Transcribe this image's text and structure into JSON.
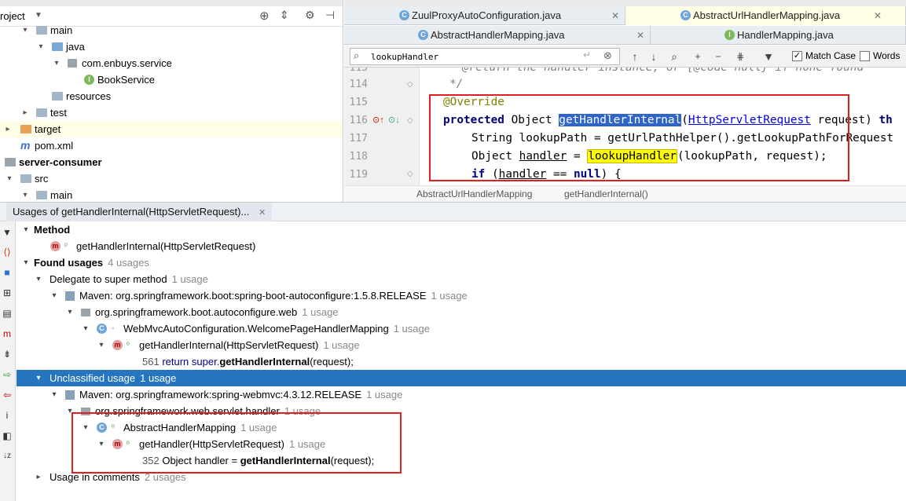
{
  "project": {
    "title": "roject",
    "tree": [
      {
        "label": "main",
        "indent": 1,
        "arrow": "down",
        "icon": "folder"
      },
      {
        "label": "java",
        "indent": 2,
        "arrow": "down",
        "icon": "folder-blue"
      },
      {
        "label": "com.enbuys.service",
        "indent": 3,
        "arrow": "down",
        "icon": "package"
      },
      {
        "label": "BookService",
        "indent": 4,
        "arrow": "",
        "icon": "interface"
      },
      {
        "label": "resources",
        "indent": 2,
        "arrow": "",
        "icon": "folder"
      },
      {
        "label": "test",
        "indent": 1,
        "arrow": "right",
        "icon": "folder"
      },
      {
        "label": "target",
        "indent": 0,
        "arrow": "right",
        "icon": "folder-orange"
      },
      {
        "label": "pom.xml",
        "indent": 0,
        "arrow": "",
        "icon": "maven"
      },
      {
        "label": "server-consumer",
        "indent": -1,
        "arrow": "",
        "icon": "module"
      },
      {
        "label": "src",
        "indent": 0,
        "arrow": "down",
        "icon": "folder"
      },
      {
        "label": "main",
        "indent": 1,
        "arrow": "down",
        "icon": "folder"
      }
    ]
  },
  "editor": {
    "tabs_row1": [
      {
        "label": "ZuulProxyAutoConfiguration.java",
        "active": false
      },
      {
        "label": "AbstractUrlHandlerMapping.java",
        "active": true
      }
    ],
    "tabs_row2": [
      {
        "label": "AbstractHandlerMapping.java",
        "active": false
      },
      {
        "label": "HandlerMapping.java",
        "active": false
      }
    ],
    "search": {
      "value": "lookupHandler",
      "match_case_label": "Match Case",
      "match_case_checked": true,
      "words_label": "Words",
      "words_checked": false
    },
    "lines": [
      {
        "num": "113",
        "text": "@return the handler instance, or {@code null} if none found"
      },
      {
        "num": "114",
        "text": "*/"
      },
      {
        "num": "115",
        "text": "@Override"
      },
      {
        "num": "116",
        "text": "protected Object getHandlerInternal(HttpServletRequest request) th"
      },
      {
        "num": "117",
        "text": "String lookupPath = getUrlPathHelper().getLookupPathForRequest"
      },
      {
        "num": "118",
        "text": "Object handler = lookupHandler(lookupPath, request);"
      },
      {
        "num": "119",
        "text": "if (handler == null) {"
      }
    ],
    "breadcrumb": [
      "AbstractUrlHandlerMapping",
      "getHandlerInternal()"
    ]
  },
  "usages": {
    "tab_title": "Usages of getHandlerInternal(HttpServletRequest)...",
    "rows": [
      {
        "label": "Method",
        "count": "",
        "bold": true
      },
      {
        "label": "getHandlerInternal(HttpServletRequest)",
        "count": ""
      },
      {
        "label": "Found usages",
        "count": "4 usages",
        "bold": true
      },
      {
        "label": "Delegate to super method",
        "count": "1 usage"
      },
      {
        "label": "Maven: org.springframework.boot:spring-boot-autoconfigure:1.5.8.RELEASE",
        "count": "1 usage"
      },
      {
        "label": "org.springframework.boot.autoconfigure.web",
        "count": "1 usage"
      },
      {
        "label": "WebMvcAutoConfiguration.WelcomePageHandlerMapping",
        "count": "1 usage"
      },
      {
        "label": "getHandlerInternal(HttpServletRequest)",
        "count": "1 usage"
      },
      {
        "num": "561",
        "pre": "return super.",
        "method": "getHandlerInternal",
        "post": "(request);"
      },
      {
        "label": "Unclassified usage",
        "count": "1 usage",
        "selected": true
      },
      {
        "label": "Maven: org.springframework:spring-webmvc:4.3.12.RELEASE",
        "count": "1 usage"
      },
      {
        "label": "org.springframework.web.servlet.handler",
        "count": "1 usage"
      },
      {
        "label": "AbstractHandlerMapping",
        "count": "1 usage"
      },
      {
        "label": "getHandler(HttpServletRequest)",
        "count": "1 usage"
      },
      {
        "num": "352",
        "pre": "Object handler = ",
        "method": "getHandlerInternal",
        "post": "(request);"
      },
      {
        "label": "Usage in comments",
        "count": "2 usages"
      }
    ]
  },
  "colors": {
    "selection": "#2675bf",
    "highlight_red": "#e02020",
    "find_highlight": "#ffff00",
    "keyword": "#000080"
  }
}
